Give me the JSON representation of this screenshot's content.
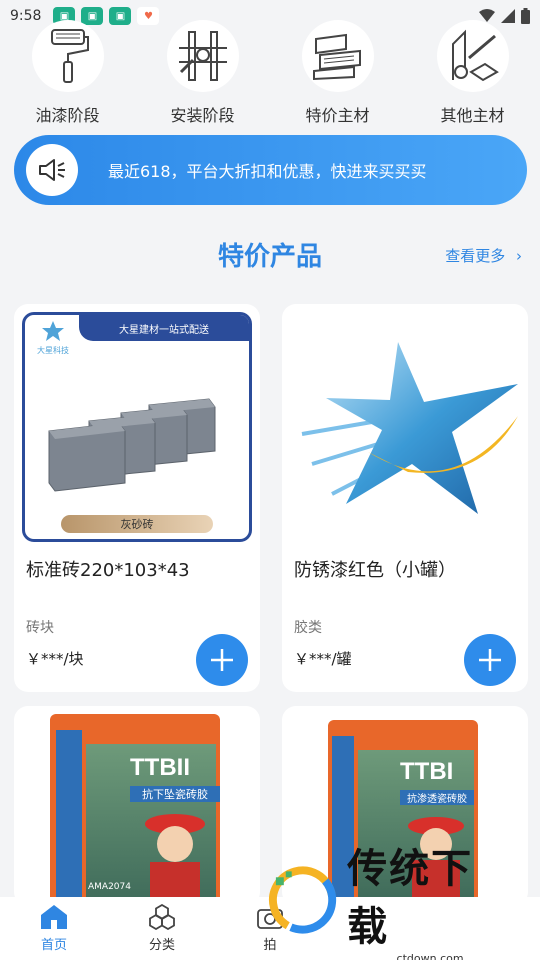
{
  "status_bar": {
    "time": "9:58"
  },
  "categories": [
    {
      "label": "油漆阶段",
      "icon": "paint-roller-icon"
    },
    {
      "label": "安装阶段",
      "icon": "wrench-pipes-icon"
    },
    {
      "label": "特价主材",
      "icon": "tiles-stack-icon"
    },
    {
      "label": "其他主材",
      "icon": "tools-box-icon"
    }
  ],
  "banner": {
    "text": "最近618，平台大折扣和优惠，快进来买买买",
    "icon": "megaphone-icon"
  },
  "section": {
    "title": "特价产品",
    "see_more": "查看更多"
  },
  "products": [
    {
      "name": "标准砖220*103*43",
      "category": "砖块",
      "price": "￥***/块",
      "image_banner": "大星建材一站式配送",
      "image_logo": "大星科技",
      "image_tag": "灰砂砖"
    },
    {
      "name": "防锈漆红色（小罐）",
      "category": "胶类",
      "price": "￥***/罐"
    },
    {
      "name_on_bag": "TTBII",
      "bag_sub": "抗下坠瓷砖胶",
      "bag_code": "AMA2074"
    },
    {
      "name_on_bag": "TTBI",
      "bag_sub": "抗渗透瓷砖胶"
    }
  ],
  "tabs": [
    {
      "label": "首页",
      "icon": "home-icon",
      "active": true
    },
    {
      "label": "分类",
      "icon": "category-icon",
      "active": false
    },
    {
      "label": "拍",
      "icon": "camera-icon",
      "active": false
    }
  ],
  "watermark": {
    "main": "传统下载",
    "sub": "ctdown.com"
  },
  "colors": {
    "accent": "#2f86e2",
    "banner_start": "#2c88e8",
    "banner_end": "#4aa6f7",
    "background": "#f3f4f6"
  }
}
